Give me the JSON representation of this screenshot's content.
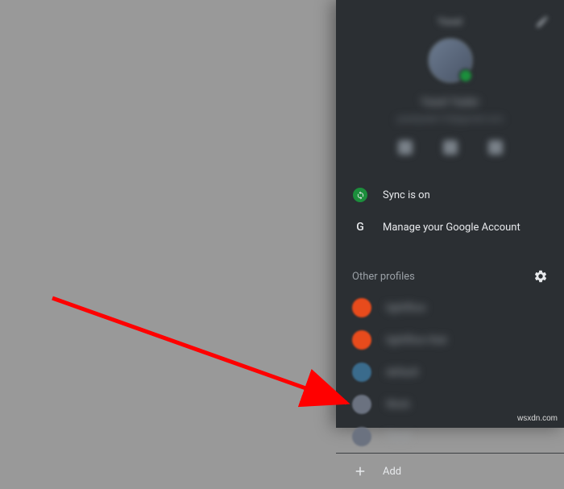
{
  "profile": {
    "title_blurred": "Yasel",
    "name_blurred": "Yasel Yader",
    "email_blurred": "yaselyader123@gmail.com"
  },
  "menu": {
    "sync_label": "Sync is on",
    "manage_label": "Manage your Google Account"
  },
  "other_profiles": {
    "header": "Other profiles",
    "items": [
      {
        "label_blurred": "lightflow",
        "avatar_color": "avatar-orange"
      },
      {
        "label_blurred": "lightflow that",
        "avatar_color": "avatar-orange"
      },
      {
        "label_blurred": "default",
        "avatar_color": "avatar-blue"
      },
      {
        "label_blurred": "Work",
        "avatar_color": "avatar-gray"
      },
      {
        "label_blurred": "Yasel",
        "avatar_color": "avatar-gray"
      }
    ]
  },
  "add": {
    "label": "Add"
  },
  "watermark": "wsxdn.com"
}
